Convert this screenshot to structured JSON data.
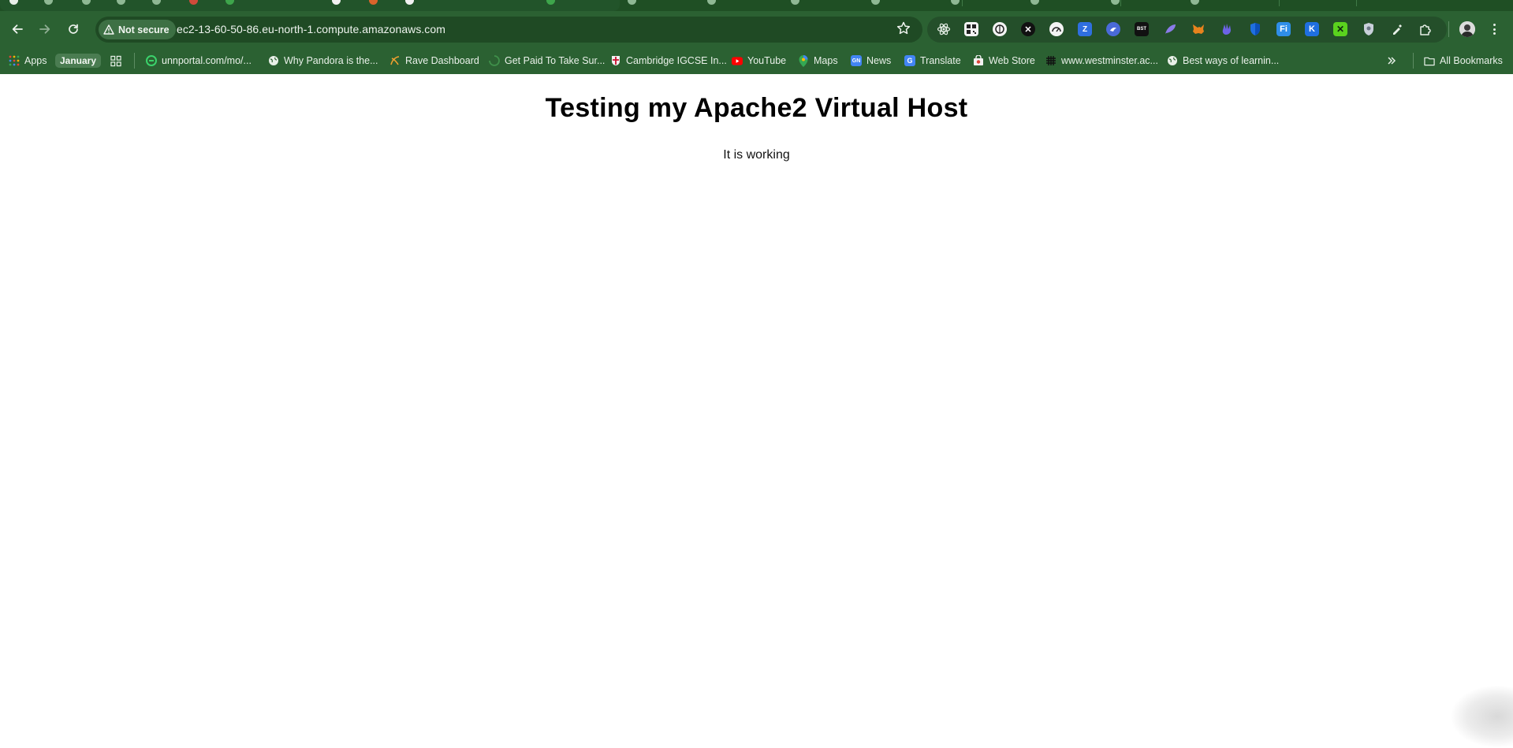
{
  "browser": {
    "colors": {
      "frame": "#2b6132",
      "tabstrip": "#1f4f24",
      "omnibox": "#1f4a24",
      "text": "#eaf1ea"
    },
    "toolbar": {
      "back_icon": "arrow-left-icon",
      "forward_icon": "arrow-right-icon",
      "reload_icon": "reload-icon",
      "security_label": "Not secure",
      "url": "ec2-13-60-50-86.eu-north-1.compute.amazonaws.com",
      "bookmark_star_icon": "star-icon",
      "extensions": [
        "react-devtools-icon",
        "qr-code-icon",
        "circle-extension-icon",
        "x-extension-icon",
        "speedometer-icon",
        "zotero-icon",
        "bird-icon",
        "bst-icon",
        "feather-icon",
        "metamask-icon",
        "hand-icon",
        "shield-icon",
        "fi-icon",
        "k-icon",
        "green-x-icon",
        "privacy-shield-icon",
        "eyedropper-icon",
        "puzzle-icon"
      ],
      "profile_icon": "avatar",
      "menu_icon": "kebab-menu-icon"
    },
    "bookmarks": {
      "apps_label": "Apps",
      "january_label": "January",
      "items": [
        {
          "label": "unnportal.com/mo/...",
          "icon": "globe-green-icon"
        },
        {
          "label": "Why Pandora is the...",
          "icon": "globe-icon"
        },
        {
          "label": "Rave Dashboard",
          "icon": "rave-icon"
        },
        {
          "label": "Get Paid To Take Sur...",
          "icon": "spinner-icon"
        },
        {
          "label": "Cambridge IGCSE In...",
          "icon": "cambridge-icon"
        },
        {
          "label": "YouTube",
          "icon": "youtube-icon"
        },
        {
          "label": "Maps",
          "icon": "maps-icon"
        },
        {
          "label": "News",
          "icon": "news-icon"
        },
        {
          "label": "Translate",
          "icon": "translate-icon"
        },
        {
          "label": "Web Store",
          "icon": "web-store-icon"
        },
        {
          "label": "www.westminster.ac...",
          "icon": "grid-icon"
        },
        {
          "label": "Best ways of learnin...",
          "icon": "globe-icon"
        }
      ],
      "overflow_icon": "chevron-double-right-icon",
      "all_bookmarks_label": "All Bookmarks"
    }
  },
  "page": {
    "heading": "Testing my Apache2 Virtual Host",
    "text": "It is working"
  }
}
